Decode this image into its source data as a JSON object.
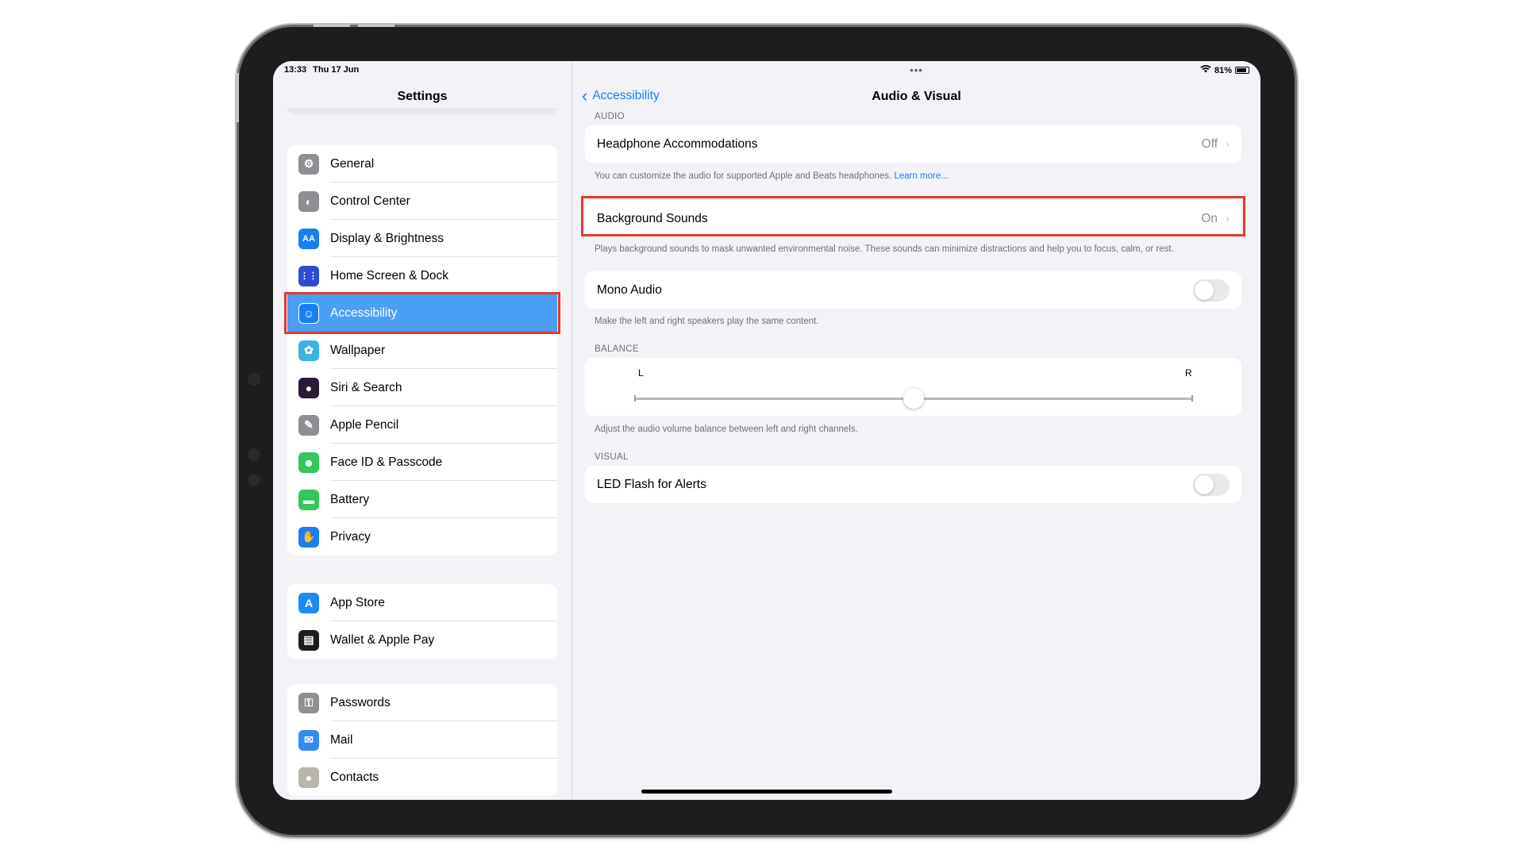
{
  "status_bar": {
    "time": "13:33",
    "date": "Thu 17 Jun",
    "battery_text": "81%",
    "multitask_dots": "•••"
  },
  "sidebar": {
    "title": "Settings",
    "groups": [
      {
        "items": [
          {
            "label": "General",
            "icon": "gear-icon",
            "color": "#8e8e93",
            "glyph": "⚙"
          },
          {
            "label": "Control Center",
            "icon": "toggles-icon",
            "color": "#8e8e93",
            "glyph": "◐"
          },
          {
            "label": "Display & Brightness",
            "icon": "text-size-icon",
            "color": "#1a7ef5",
            "glyph": "AA"
          },
          {
            "label": "Home Screen & Dock",
            "icon": "app-grid-icon",
            "color": "#2c4bd3",
            "glyph": "⋮⋮"
          },
          {
            "label": "Accessibility",
            "icon": "accessibility-icon",
            "color": "#1a7ef5",
            "glyph": "☺",
            "active": true
          },
          {
            "label": "Wallpaper",
            "icon": "flower-icon",
            "color": "#3cb2e8",
            "glyph": "✿"
          },
          {
            "label": "Siri & Search",
            "icon": "siri-icon",
            "color": "#2a1a3a",
            "glyph": "●"
          },
          {
            "label": "Apple Pencil",
            "icon": "pencil-icon",
            "color": "#8e8e93",
            "glyph": "✎"
          },
          {
            "label": "Face ID & Passcode",
            "icon": "face-id-icon",
            "color": "#34c759",
            "glyph": "☻"
          },
          {
            "label": "Battery",
            "icon": "battery-icon",
            "color": "#34c759",
            "glyph": "▬"
          },
          {
            "label": "Privacy",
            "icon": "hand-icon",
            "color": "#1a7ef5",
            "glyph": "✋"
          }
        ]
      },
      {
        "items": [
          {
            "label": "App Store",
            "icon": "app-store-icon",
            "color": "#1a8cf5",
            "glyph": "A"
          },
          {
            "label": "Wallet & Apple Pay",
            "icon": "wallet-icon",
            "color": "#1c1c1e",
            "glyph": "▤"
          }
        ]
      },
      {
        "items": [
          {
            "label": "Passwords",
            "icon": "key-icon",
            "color": "#8e8e93",
            "glyph": "⚿"
          },
          {
            "label": "Mail",
            "icon": "mail-icon",
            "color": "#2f8cf5",
            "glyph": "✉"
          },
          {
            "label": "Contacts",
            "icon": "contacts-icon",
            "color": "#b8b5ad",
            "glyph": "●"
          }
        ]
      }
    ]
  },
  "detail": {
    "back_label": "Accessibility",
    "title": "Audio & Visual",
    "audio_header": "AUDIO",
    "headphone": {
      "label": "Headphone Accommodations",
      "value": "Off"
    },
    "headphone_footer": "You can customize the audio for supported Apple and Beats headphones.",
    "learn_more": "Learn more...",
    "background": {
      "label": "Background Sounds",
      "value": "On"
    },
    "background_footer": "Plays background sounds to mask unwanted environmental noise. These sounds can minimize distractions and help you to focus, calm, or rest.",
    "mono": {
      "label": "Mono Audio",
      "enabled": false
    },
    "mono_footer": "Make the left and right speakers play the same content.",
    "balance_header": "BALANCE",
    "balance": {
      "left_label": "L",
      "right_label": "R",
      "value": 0.5
    },
    "balance_footer": "Adjust the audio volume balance between left and right channels.",
    "visual_header": "VISUAL",
    "led": {
      "label": "LED Flash for Alerts",
      "enabled": false
    }
  },
  "colors": {
    "accent": "#1a7ef5",
    "highlight_box": "#e23b2e",
    "active_row": "#4a9ef5"
  }
}
